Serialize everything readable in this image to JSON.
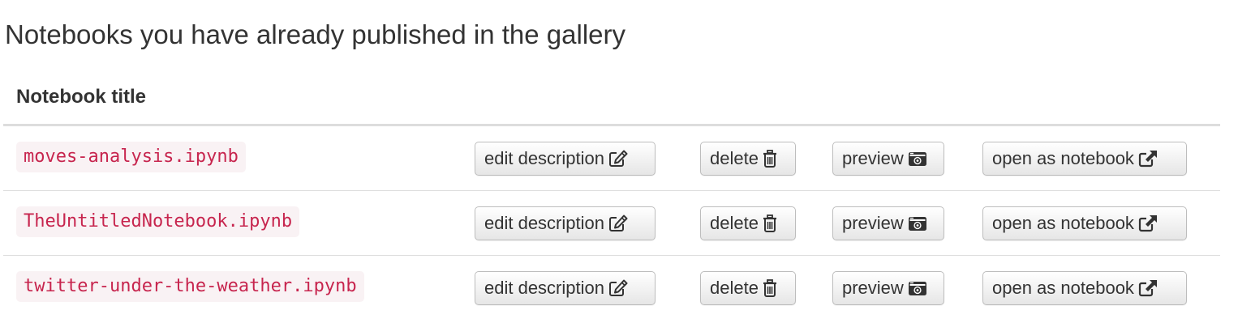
{
  "page": {
    "title": "Notebooks you have already published in the gallery"
  },
  "table": {
    "header": {
      "title_label": "Notebook title"
    },
    "rows": [
      {
        "name": "moves-analysis.ipynb",
        "edit_label": "edit description",
        "delete_label": "delete",
        "preview_label": "preview",
        "open_label": "open as notebook"
      },
      {
        "name": "TheUntitledNotebook.ipynb",
        "edit_label": "edit description",
        "delete_label": "delete",
        "preview_label": "preview",
        "open_label": "open as notebook"
      },
      {
        "name": "twitter-under-the-weather.ipynb",
        "edit_label": "edit description",
        "delete_label": "delete",
        "preview_label": "preview",
        "open_label": "open as notebook"
      }
    ]
  },
  "icons": {
    "edit": "pencil-square-icon",
    "delete": "trash-icon",
    "preview": "camera-icon",
    "open": "external-link-icon"
  },
  "colors": {
    "code_text": "#c7254e",
    "code_background": "#f9f2f4",
    "button_border": "#bdbdbd",
    "divider": "#dddddd"
  }
}
